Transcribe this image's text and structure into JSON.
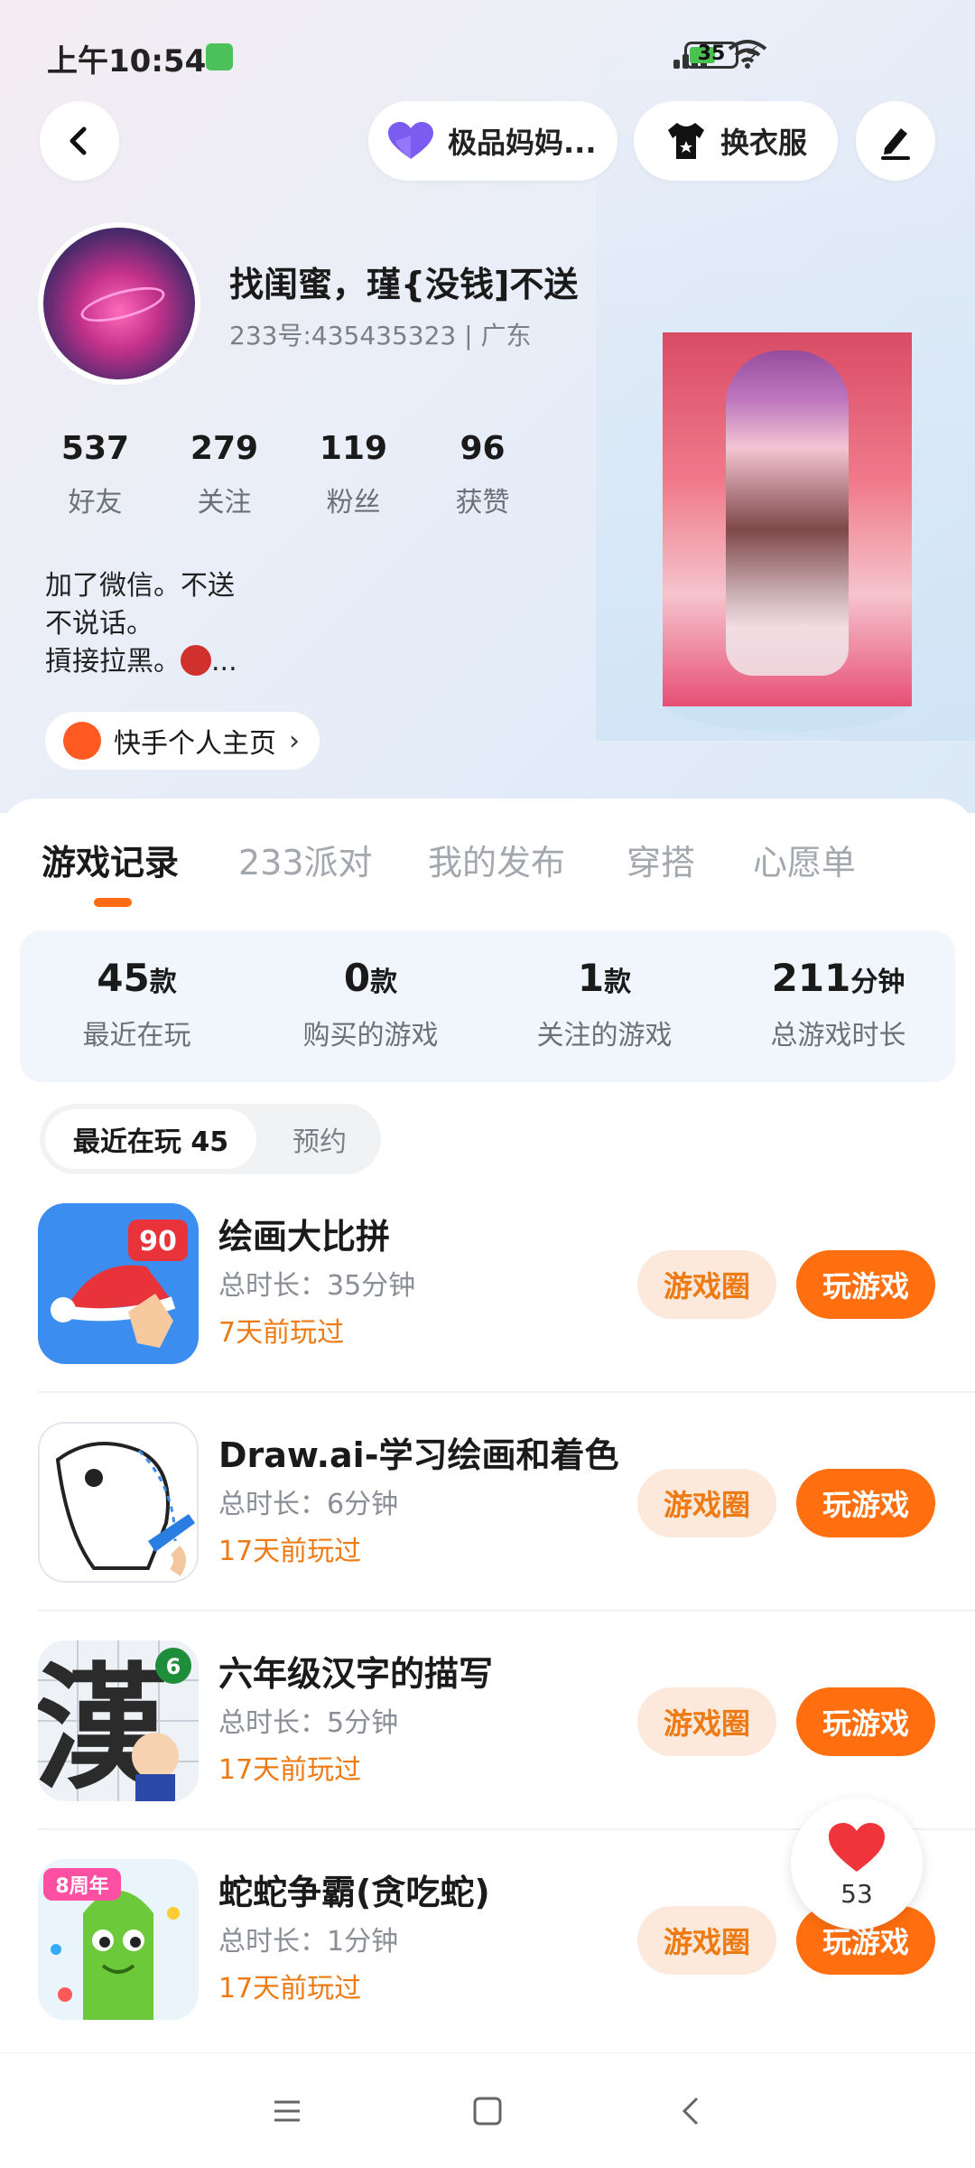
{
  "status_bar": {
    "time": "上午10:54",
    "battery": "35"
  },
  "header": {
    "badge_label": "极品妈妈...",
    "outfit_label": "换衣服"
  },
  "profile": {
    "name": "找闺蜜，瑾{没钱]不送",
    "uid_line": "233号:435435323 | 广东",
    "stats": [
      {
        "value": "537",
        "label": "好友"
      },
      {
        "value": "279",
        "label": "关注"
      },
      {
        "value": "119",
        "label": "粉丝"
      },
      {
        "value": "96",
        "label": "获赞"
      }
    ],
    "bio_lines": [
      "加了微信。不送",
      "不说话。",
      "摃接拉黑。"
    ],
    "bio_more": "...",
    "kuaishou_link": "快手个人主页"
  },
  "tabs": [
    "游戏记录",
    "233派对",
    "我的发布",
    "穿搭",
    "心愿单"
  ],
  "summary": [
    {
      "value": "45",
      "unit": "款",
      "label": "最近在玩"
    },
    {
      "value": "0",
      "unit": "款",
      "label": "购买的游戏"
    },
    {
      "value": "1",
      "unit": "款",
      "label": "关注的游戏"
    },
    {
      "value": "211",
      "unit": "分钟",
      "label": "总游戏时长"
    }
  ],
  "segment": {
    "active": "最近在玩 45",
    "other": "预约"
  },
  "games": [
    {
      "title": "绘画大比拼",
      "duration": "总时长：35分钟",
      "last_played": "7天前玩过",
      "icon_badge": "90"
    },
    {
      "title": "Draw.ai-学习绘画和着色",
      "duration": "总时长：6分钟",
      "last_played": "17天前玩过"
    },
    {
      "title": "六年级汉字的描写",
      "duration": "总时长：5分钟",
      "last_played": "17天前玩过",
      "icon_char": "漢",
      "icon_badge": "6"
    },
    {
      "title": "蛇蛇争霸(贪吃蛇)",
      "duration": "总时长：1分钟",
      "last_played": "17天前玩过",
      "icon_badge": "8周年"
    }
  ],
  "game_buttons": {
    "circle": "游戏圈",
    "play": "玩游戏"
  },
  "like": {
    "count": "53"
  },
  "colors": {
    "accent": "#ff6f0f",
    "accent_light": "#fde9dc",
    "hero_bg": "#e9eef8"
  },
  "icons": [
    "back-arrow-icon",
    "purple-heart-icon",
    "tshirt-icon",
    "pencil-icon",
    "kuaishou-icon",
    "heart-icon",
    "menu-icon",
    "home-icon",
    "back-icon"
  ]
}
